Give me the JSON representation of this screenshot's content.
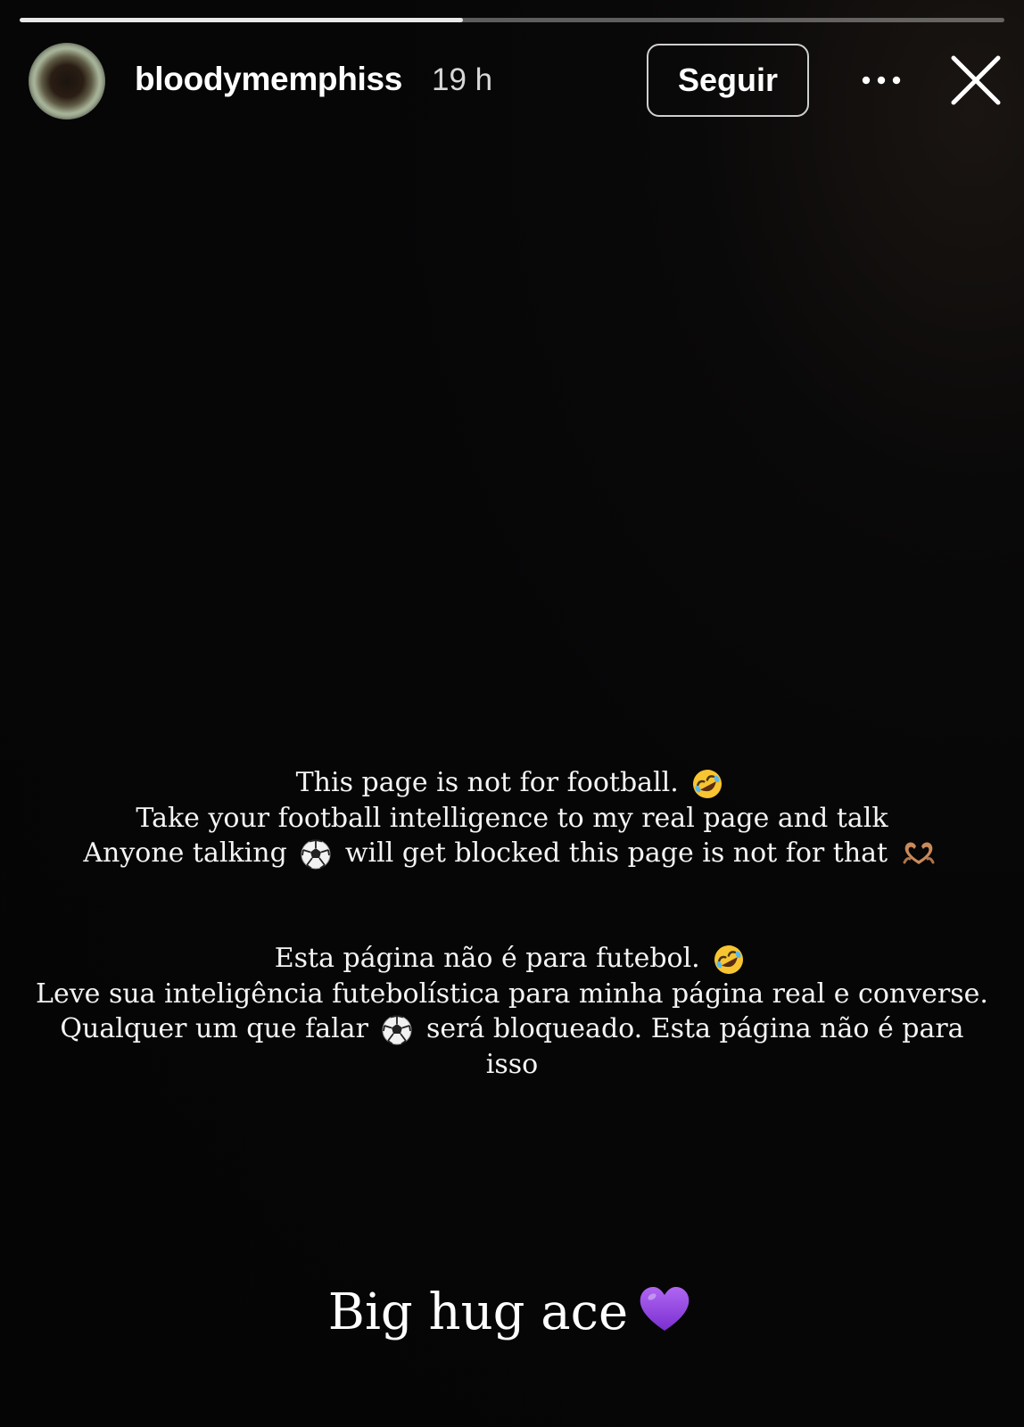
{
  "story": {
    "progress_fraction": 0.45,
    "background_color": "#060607",
    "accent_purple": "#8b3ddb"
  },
  "header": {
    "username": "bloodymemphiss",
    "timestamp": "19 h",
    "follow_label": "Seguir",
    "icons": [
      "avatar",
      "more-icon",
      "close-icon"
    ]
  },
  "text_english": {
    "line1": "This page is not for football.",
    "line2": "Take your football intelligence to my real page and talk",
    "line3_a": "Anyone talking",
    "line3_b": "will get blocked this page is not for that"
  },
  "text_portuguese": {
    "line1": "Esta página não é para futebol.",
    "line2": "Leve sua inteligência futebolística para minha página real e converse.",
    "line3_a": "Qualquer um que falar",
    "line3_b": "será bloqueado. Esta página não é para",
    "line4": "isso"
  },
  "closing": {
    "text": "Big hug ace"
  },
  "emojis": {
    "laughing": "rolling-on-floor-laughing-emoji",
    "ball": "soccer-ball-emoji",
    "heart_hands": "heart-hands-emoji",
    "heart": "purple-heart-emoji"
  }
}
